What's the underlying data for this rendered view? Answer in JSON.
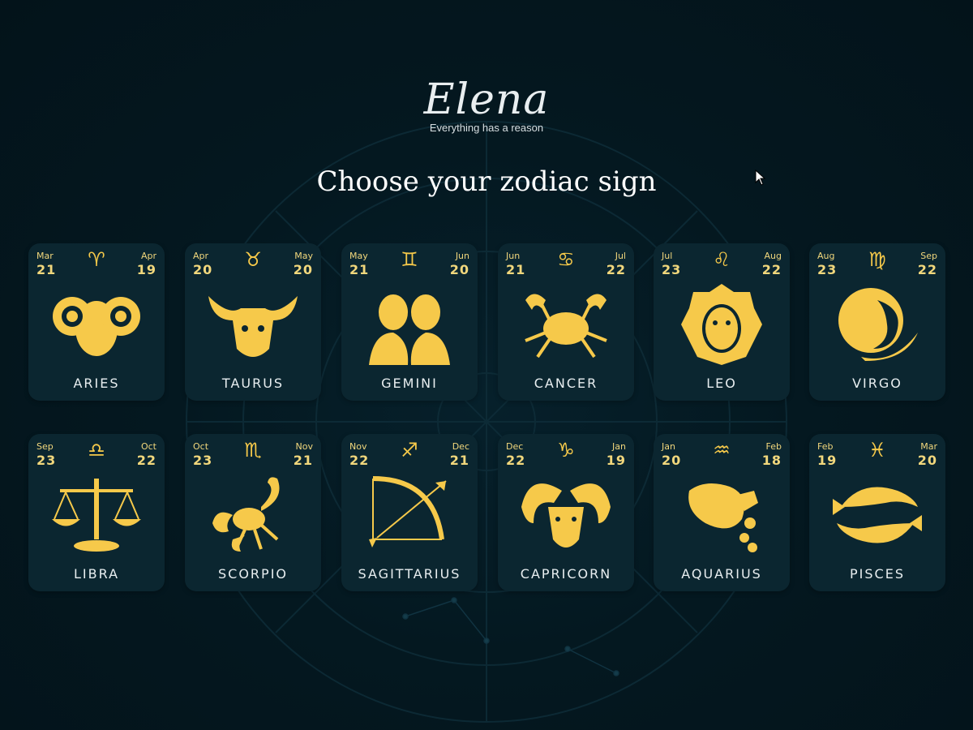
{
  "brand": {
    "name": "Elena",
    "tagline": "Everything has a reason"
  },
  "heading": "Choose your zodiac sign",
  "colors": {
    "background": "#03141c",
    "card": "#0b2630",
    "gold": "#f6c94a",
    "date": "#f1d77c"
  },
  "signs": [
    {
      "name": "ARIES",
      "glyph": "♈",
      "start_month": "Mar",
      "start_day": "21",
      "end_month": "Apr",
      "end_day": "19",
      "icon": "ram-icon"
    },
    {
      "name": "TAURUS",
      "glyph": "♉",
      "start_month": "Apr",
      "start_day": "20",
      "end_month": "May",
      "end_day": "20",
      "icon": "bull-icon"
    },
    {
      "name": "GEMINI",
      "glyph": "♊",
      "start_month": "May",
      "start_day": "21",
      "end_month": "Jun",
      "end_day": "20",
      "icon": "twins-icon"
    },
    {
      "name": "CANCER",
      "glyph": "♋",
      "start_month": "Jun",
      "start_day": "21",
      "end_month": "Jul",
      "end_day": "22",
      "icon": "crab-icon"
    },
    {
      "name": "LEO",
      "glyph": "♌",
      "start_month": "Jul",
      "start_day": "23",
      "end_month": "Aug",
      "end_day": "22",
      "icon": "lion-icon"
    },
    {
      "name": "VIRGO",
      "glyph": "♍",
      "start_month": "Aug",
      "start_day": "23",
      "end_month": "Sep",
      "end_day": "22",
      "icon": "maiden-icon"
    },
    {
      "name": "LIBRA",
      "glyph": "♎",
      "start_month": "Sep",
      "start_day": "23",
      "end_month": "Oct",
      "end_day": "22",
      "icon": "scales-icon"
    },
    {
      "name": "SCORPIO",
      "glyph": "♏",
      "start_month": "Oct",
      "start_day": "23",
      "end_month": "Nov",
      "end_day": "21",
      "icon": "scorpion-icon"
    },
    {
      "name": "SAGITTARIUS",
      "glyph": "♐",
      "start_month": "Nov",
      "start_day": "22",
      "end_month": "Dec",
      "end_day": "21",
      "icon": "bow-arrow-icon"
    },
    {
      "name": "CAPRICORN",
      "glyph": "♑",
      "start_month": "Dec",
      "start_day": "22",
      "end_month": "Jan",
      "end_day": "19",
      "icon": "goat-icon"
    },
    {
      "name": "AQUARIUS",
      "glyph": "♒",
      "start_month": "Jan",
      "start_day": "20",
      "end_month": "Feb",
      "end_day": "18",
      "icon": "water-bearer-icon"
    },
    {
      "name": "PISCES",
      "glyph": "♓",
      "start_month": "Feb",
      "start_day": "19",
      "end_month": "Mar",
      "end_day": "20",
      "icon": "fish-icon"
    }
  ]
}
